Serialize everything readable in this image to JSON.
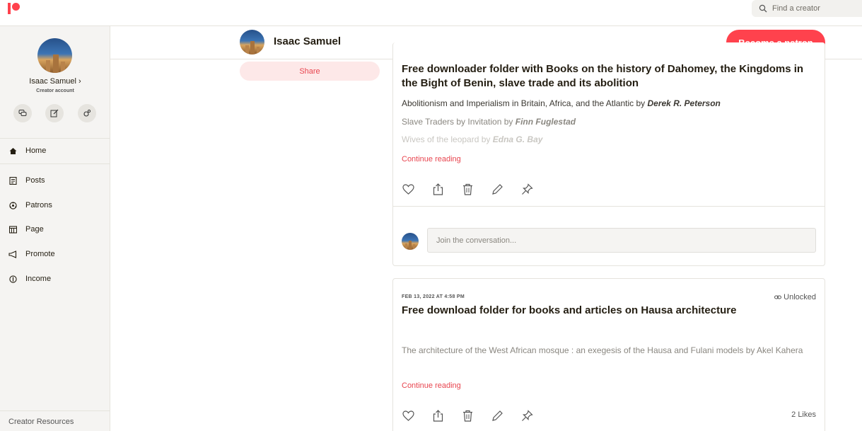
{
  "search": {
    "placeholder": "Find a creator"
  },
  "sidebar": {
    "creator_name": "Isaac Samuel",
    "creator_role": "Creator account",
    "nav": [
      {
        "label": "Home",
        "icon": "home-icon"
      },
      {
        "label": "Posts",
        "icon": "posts-icon"
      },
      {
        "label": "Patrons",
        "icon": "patrons-icon"
      },
      {
        "label": "Page",
        "icon": "page-icon"
      },
      {
        "label": "Promote",
        "icon": "megaphone-icon"
      },
      {
        "label": "Income",
        "icon": "income-icon"
      }
    ],
    "creator_resources": "Creator Resources"
  },
  "header": {
    "creator_name": "Isaac Samuel",
    "become_patron": "Become a patron"
  },
  "share_label": "Share",
  "posts": [
    {
      "title": "Free downloader folder with Books on the history of Dahomey, the Kingdoms in the Bight of Benin, slave trade and its abolition",
      "books": [
        {
          "title": "Abolitionism and Imperialism in Britain, Africa, and the Atlantic by ",
          "author": "Derek R.  Peterson"
        },
        {
          "title": "Slave Traders by Invitation by ",
          "author": "Finn Fuglestad"
        },
        {
          "title": "Wives of the leopard by ",
          "author": "Edna G. Bay"
        }
      ],
      "continue": "Continue reading",
      "comment_placeholder": "Join the conversation..."
    },
    {
      "date": "FEB 13, 2022 AT 4:58 PM",
      "status": "Unlocked",
      "title": "Free download folder for books and articles on Hausa architecture",
      "excerpt": "The architecture of the West African mosque : an exegesis of the Hausa and Fulani models by Akel Kahera",
      "continue": "Continue reading",
      "likes": "2 Likes"
    }
  ],
  "colors": {
    "accent": "#ff424d",
    "text": "#241e12",
    "sidebar_bg": "#f5f4f2"
  }
}
